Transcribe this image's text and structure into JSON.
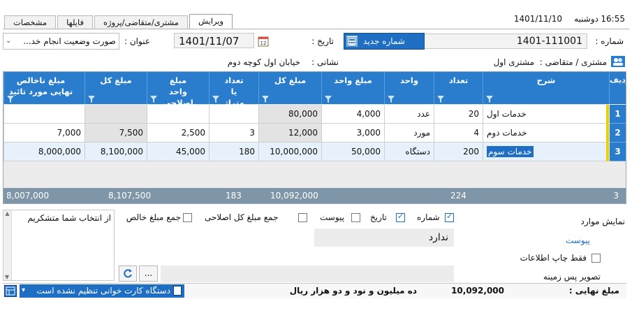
{
  "statusbar_top": {
    "time": "16:55",
    "day": "دوشنبه",
    "date": "1401/11/10"
  },
  "tabs": [
    "ویرایش",
    "مشتری/متقاضی/پروژه",
    "فایلها",
    "مشخصات"
  ],
  "form": {
    "number_label": "شماره :",
    "number_value": "1401-111001",
    "new_number_button": "شماره جدید",
    "date_label": "تاریخ :",
    "date_value": "1401/11/07",
    "title_label": "عنوان :",
    "title_value": "صورت وضعیت انجام خد...",
    "customer_label": "مشتری / متقاضی :",
    "customer_value": "مشتری اول",
    "address_label": "نشانی :",
    "address_value": "خیابان اول کوچه دوم"
  },
  "grid": {
    "columns": [
      "ردیف",
      "شرح",
      "تعداد",
      "واحد",
      "مبلغ واحد",
      "مبلغ کل",
      "تعداد یا متراژ",
      "مبلغ واحد اصلاحی",
      "مبلغ کل",
      "مبلغ ناخالص نهایی مورد تائید"
    ],
    "rows": [
      {
        "n": "1",
        "desc": "خدمات اول",
        "qty": "20",
        "unit": "عدد",
        "price": "4,000",
        "total": "80,000",
        "qty2": "",
        "price2": "",
        "total2": "",
        "final": ""
      },
      {
        "n": "2",
        "desc": "خدمات دوم",
        "qty": "4",
        "unit": "مورد",
        "price": "3,000",
        "total": "12,000",
        "qty2": "3",
        "price2": "2,500",
        "total2": "7,500",
        "final": "7,000"
      },
      {
        "n": "3",
        "desc": "خدمات سوم",
        "qty": "200",
        "unit": "دستگاه",
        "price": "50,000",
        "total": "10,000,000",
        "qty2": "180",
        "price2": "45,000",
        "total2": "8,100,000",
        "final": "8,000,000"
      }
    ],
    "totals": {
      "count": "3",
      "qty": "224",
      "total": "10,092,000",
      "qty2": "183",
      "total2": "8,107,500",
      "final": "8,007,000"
    }
  },
  "options": {
    "show_items_label": "نمایش موارد",
    "checkboxes": [
      {
        "label": "شماره",
        "checked": true
      },
      {
        "label": "تاریخ",
        "checked": true
      },
      {
        "label": "پیوست",
        "checked": false
      },
      {
        "label": "جمع مبلغ کل اصلاحی",
        "checked": false
      },
      {
        "label": "جمع مبلغ خالص",
        "checked": false
      }
    ],
    "attachment_label": "پیوست",
    "attachment_value": "ندارد",
    "print_only_label": "فقط چاپ اطلاعات",
    "background_label": "تصویر پس زمینه",
    "browse_button": "...",
    "thanks_text": "از انتخاب شما متشکریم"
  },
  "footer": {
    "final_amount_label": "مبلغ نهایی :",
    "final_amount_value": "10,092,000",
    "final_amount_words": "ده میلیون و نود و دو هزار  ریال",
    "card_reader_text": "دستگاه کارت خوانی تنظیم نشده است"
  },
  "colors": {
    "header_blue": "#2a7ccc",
    "button_blue": "#1e6fc4",
    "summary_gray": "#7f95a8"
  }
}
